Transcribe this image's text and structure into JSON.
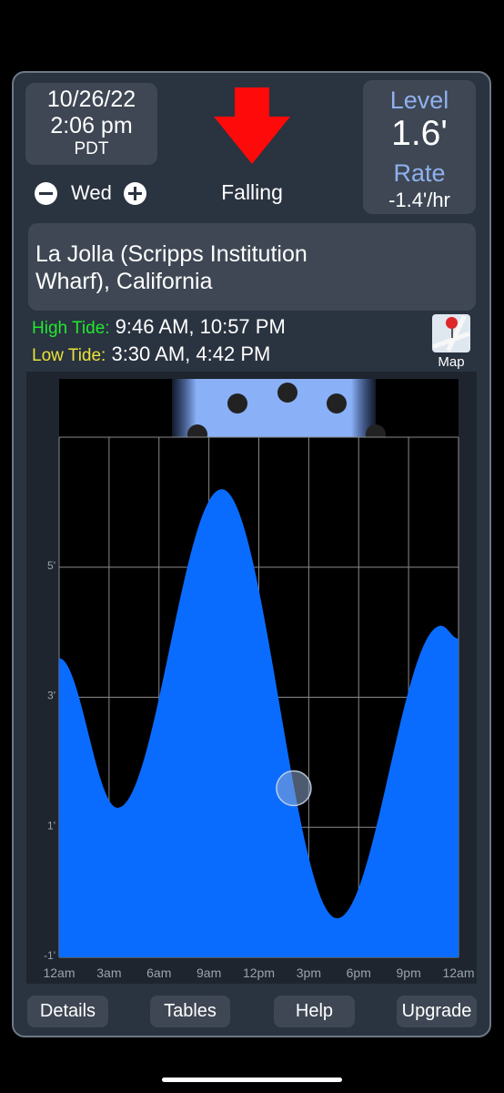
{
  "header": {
    "date": "10/26/22",
    "time": "2:06 pm",
    "timezone": "PDT",
    "day": "Wed",
    "trend": "Falling",
    "trend_icon": "down-arrow-icon",
    "trend_color": "#ff0000"
  },
  "level": {
    "level_label": "Level",
    "level_value": "1.6'",
    "rate_label": "Rate",
    "rate_value": "-1.4'/hr"
  },
  "station": {
    "line1": "La Jolla (Scripps Institution",
    "line2": "Wharf), California"
  },
  "tides": {
    "high_label": "High Tide:",
    "high_times": "9:46 AM, 10:57 PM",
    "low_label": "Low Tide:",
    "low_times": "3:30 AM, 4:42 PM"
  },
  "map": {
    "label": "Map",
    "icon": "map-pin-icon"
  },
  "chart_data": {
    "type": "area",
    "y_tick_labels": [
      "5'",
      "3'",
      "1'",
      "-1'"
    ],
    "x_tick_labels": [
      "12am",
      "3am",
      "6am",
      "9am",
      "12pm",
      "3pm",
      "6pm",
      "9pm",
      "12am"
    ],
    "ylim": [
      -1,
      7
    ],
    "xlim_hours": [
      0,
      24
    ],
    "grid": true,
    "fill_color": "#0a6cff",
    "x_hours": [
      0,
      3.5,
      9.77,
      16.7,
      22.95,
      24
    ],
    "y_feet": [
      3.6,
      1.3,
      6.2,
      -0.4,
      4.1,
      3.9
    ],
    "current": {
      "hour": 14.1,
      "feet": 1.6
    },
    "moon_indicator": "moon-phase-dots"
  },
  "buttons": [
    "Details",
    "Tables",
    "Help",
    "Upgrade"
  ]
}
